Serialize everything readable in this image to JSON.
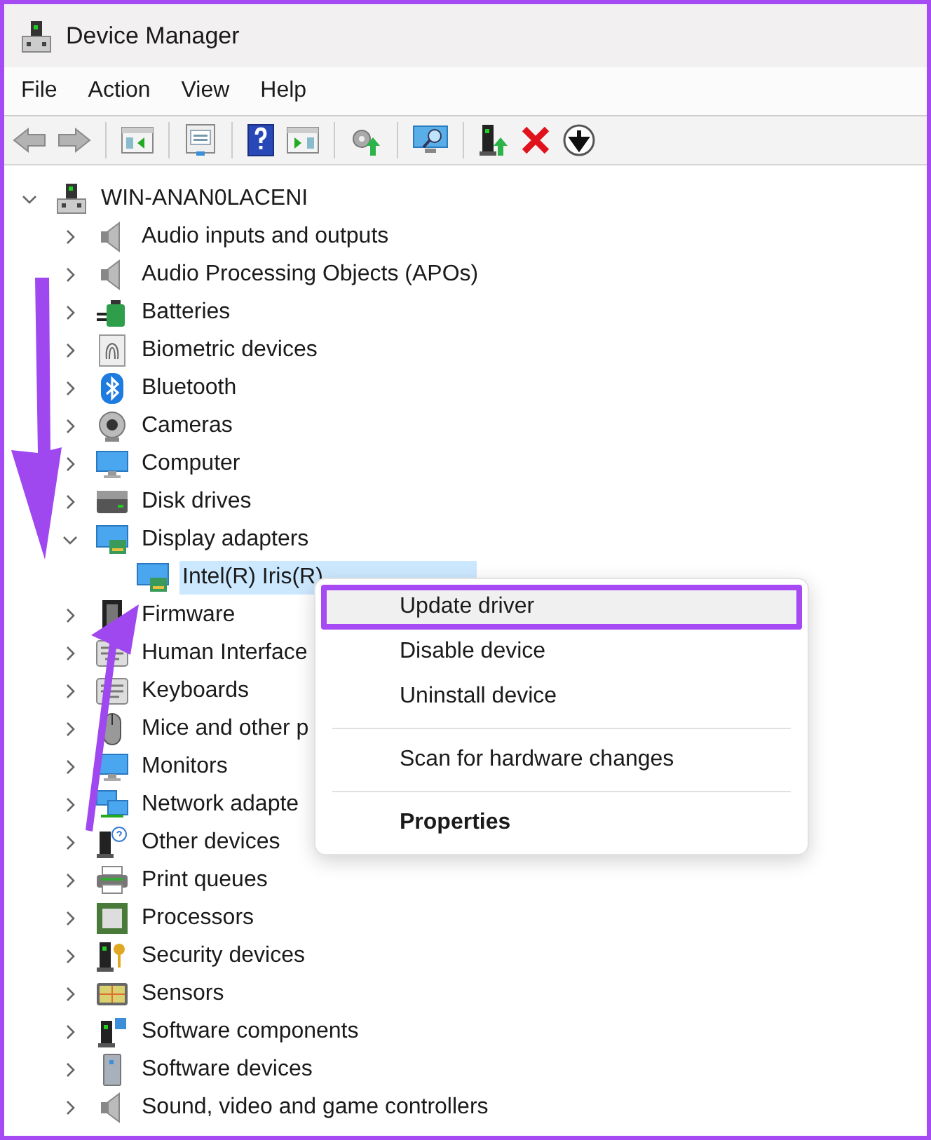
{
  "window": {
    "title": "Device Manager"
  },
  "menu_bar": [
    "File",
    "Action",
    "View",
    "Help"
  ],
  "nav_buttons": [
    {
      "disabled": true
    },
    {
      "disabled": true
    }
  ],
  "tree": {
    "label": "WIN-ANAN0LACENI",
    "expanded": true,
    "selected": false,
    "children": [
      {
        "label": "Audio inputs and outputs",
        "expanded": false,
        "selected": false
      },
      {
        "label": "Audio Processing Objects (APOs)",
        "expanded": false,
        "selected": false
      },
      {
        "label": "Batteries",
        "expanded": false,
        "selected": false
      },
      {
        "label": "Biometric devices",
        "expanded": false,
        "selected": false
      },
      {
        "label": "Bluetooth",
        "expanded": false,
        "selected": false
      },
      {
        "label": "Cameras",
        "expanded": false,
        "selected": false
      },
      {
        "label": "Computer",
        "expanded": false,
        "selected": false
      },
      {
        "label": "Disk drives",
        "expanded": false,
        "selected": false
      },
      {
        "label": "Display adapters",
        "expanded": true,
        "selected": false,
        "children": [
          {
            "label": "Intel(R) Iris(R)",
            "selected": true
          }
        ]
      },
      {
        "label": "Firmware",
        "expanded": false,
        "selected": false
      },
      {
        "label": "Human Interface",
        "expanded": false,
        "selected": false
      },
      {
        "label": "Keyboards",
        "expanded": false,
        "selected": false
      },
      {
        "label": "Mice and other p",
        "expanded": false,
        "selected": false
      },
      {
        "label": "Monitors",
        "expanded": false,
        "selected": false
      },
      {
        "label": "Network adapte",
        "expanded": false,
        "selected": false
      },
      {
        "label": "Other devices",
        "expanded": false,
        "selected": false
      },
      {
        "label": "Print queues",
        "expanded": false,
        "selected": false
      },
      {
        "label": "Processors",
        "expanded": false,
        "selected": false
      },
      {
        "label": "Security devices",
        "expanded": false,
        "selected": false
      },
      {
        "label": "Sensors",
        "expanded": false,
        "selected": false
      },
      {
        "label": "Software components",
        "expanded": false,
        "selected": false
      },
      {
        "label": "Software devices",
        "expanded": false,
        "selected": false
      },
      {
        "label": "Sound, video and game controllers",
        "expanded": false,
        "selected": false
      }
    ]
  },
  "context_menu": [
    {
      "kind": "item",
      "label": "Update driver",
      "highlighted": true,
      "default": false
    },
    {
      "kind": "item",
      "label": "Disable device",
      "highlighted": false,
      "default": false
    },
    {
      "kind": "item",
      "label": "Uninstall device",
      "highlighted": false,
      "default": false
    },
    {
      "kind": "separator"
    },
    {
      "kind": "item",
      "label": "Scan for hardware changes",
      "highlighted": false,
      "default": false
    },
    {
      "kind": "separator"
    },
    {
      "kind": "item",
      "label": "Properties",
      "highlighted": false,
      "default": true
    }
  ]
}
